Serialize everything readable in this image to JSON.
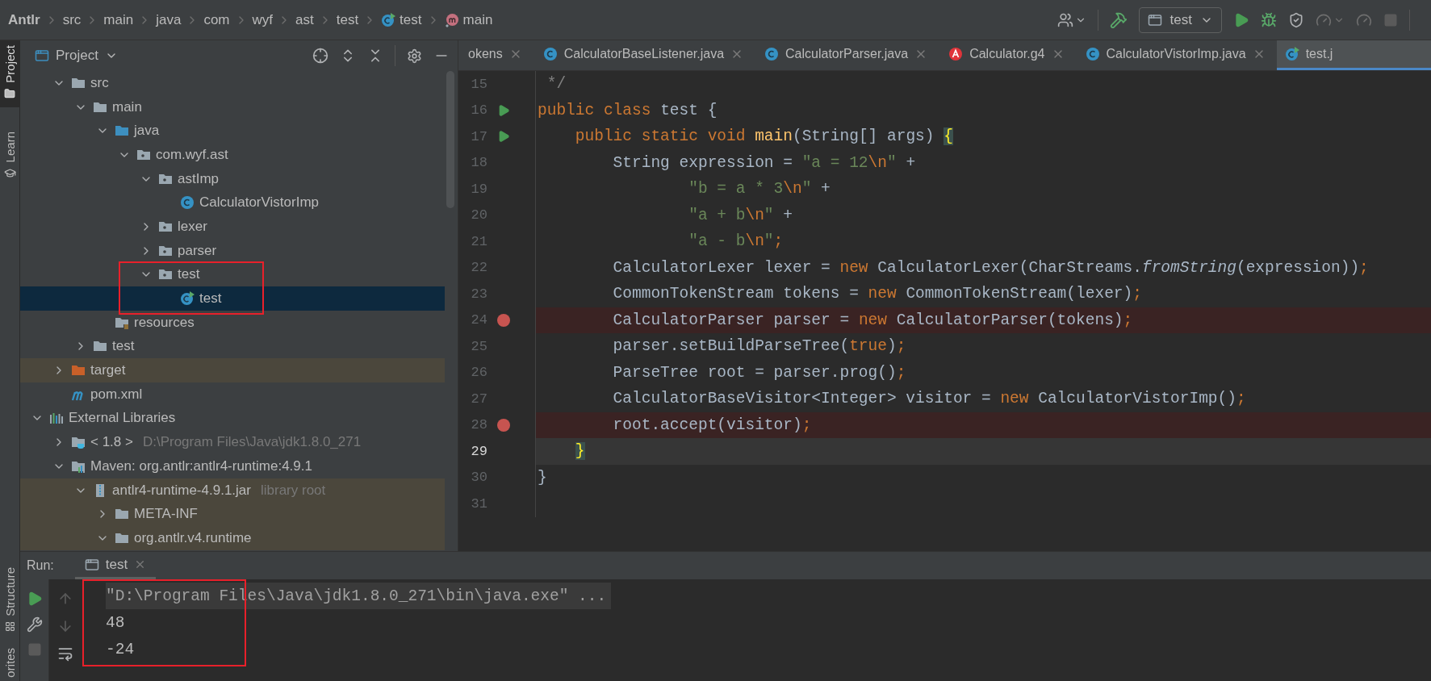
{
  "breadcrumbs": [
    {
      "label": "Antlr",
      "kind": "project"
    },
    {
      "label": "src",
      "kind": "plain"
    },
    {
      "label": "main",
      "kind": "plain"
    },
    {
      "label": "java",
      "kind": "plain"
    },
    {
      "label": "com",
      "kind": "plain"
    },
    {
      "label": "wyf",
      "kind": "plain"
    },
    {
      "label": "ast",
      "kind": "plain"
    },
    {
      "label": "test",
      "kind": "plain"
    },
    {
      "label": "test",
      "kind": "run-class"
    },
    {
      "label": "main",
      "kind": "method"
    }
  ],
  "toolbar": {
    "run_config": "test"
  },
  "side_tabs_top": [
    {
      "label": "Project",
      "selected": true,
      "kind": "folder"
    },
    {
      "label": "Learn",
      "selected": false,
      "kind": "hat"
    }
  ],
  "side_tabs_bottom": [
    {
      "label": "Structure",
      "kind": "structure"
    },
    {
      "label": "orites",
      "kind": "none"
    }
  ],
  "project_panel": {
    "title": "Project"
  },
  "tree": {
    "project_children": [
      {
        "label": "src",
        "kind": "folder",
        "expanded": true,
        "selected": false,
        "shaded": false,
        "children": [
          {
            "label": "main",
            "kind": "folder",
            "expanded": true,
            "selected": false,
            "shaded": false,
            "children": [
              {
                "label": "java",
                "kind": "source-folder",
                "expanded": true,
                "selected": false,
                "shaded": false,
                "children": [
                  {
                    "label": "com.wyf.ast",
                    "kind": "package",
                    "expanded": true,
                    "selected": false,
                    "shaded": false,
                    "children": [
                      {
                        "label": "astImp",
                        "kind": "package",
                        "expanded": true,
                        "selected": false,
                        "shaded": false,
                        "children": [
                          {
                            "label": "CalculatorVistorImp",
                            "kind": "class",
                            "selected": false,
                            "shaded": false
                          }
                        ]
                      },
                      {
                        "label": "lexer",
                        "kind": "package",
                        "expanded": false,
                        "selected": false,
                        "shaded": false
                      },
                      {
                        "label": "parser",
                        "kind": "package",
                        "expanded": false,
                        "selected": false,
                        "shaded": false
                      },
                      {
                        "label": "test",
                        "kind": "package",
                        "expanded": true,
                        "selected": false,
                        "shaded": false,
                        "children": [
                          {
                            "label": "test",
                            "kind": "run-class",
                            "selected": true,
                            "shaded": false
                          }
                        ]
                      }
                    ]
                  }
                ]
              },
              {
                "label": "resources",
                "kind": "resources",
                "selected": false,
                "shaded": false
              }
            ]
          },
          {
            "label": "test",
            "kind": "folder",
            "expanded": false,
            "selected": false,
            "shaded": false
          }
        ]
      },
      {
        "label": "target",
        "kind": "target",
        "expanded": false,
        "selected": false,
        "shaded": true
      },
      {
        "label": "pom.xml",
        "kind": "maven",
        "selected": false,
        "shaded": false
      }
    ],
    "items": [
      {
        "label": "External Libraries",
        "kind": "libraries",
        "expanded": true,
        "selected": false,
        "shaded": false,
        "children": [
          {
            "label": "< 1.8 >",
            "hint": "D:\\Program Files\\Java\\jdk1.8.0_271",
            "kind": "jdk",
            "expanded": false,
            "selected": false,
            "shaded": false
          },
          {
            "label": "Maven: org.antlr:antlr4-runtime:4.9.1",
            "kind": "maven-lib",
            "expanded": true,
            "selected": false,
            "shaded": false,
            "children": [
              {
                "label": "antlr4-runtime-4.9.1.jar",
                "hint": "library root",
                "kind": "jar",
                "expanded": true,
                "selected": false,
                "shaded": true,
                "children": [
                  {
                    "label": "META-INF",
                    "kind": "folder",
                    "expanded": false,
                    "selected": false,
                    "shaded": true
                  },
                  {
                    "label": "org.antlr.v4.runtime",
                    "kind": "folder",
                    "expanded": true,
                    "selected": false,
                    "shaded": true
                  }
                ]
              }
            ]
          }
        ]
      }
    ]
  },
  "editor_tabs": [
    {
      "label": "okens",
      "kind": "none",
      "selected": false
    },
    {
      "label": "CalculatorBaseListener.java",
      "kind": "class",
      "selected": false
    },
    {
      "label": "CalculatorParser.java",
      "kind": "class",
      "selected": false
    },
    {
      "label": "Calculator.g4",
      "kind": "antlr",
      "selected": false
    },
    {
      "label": "CalculatorVistorImp.java",
      "kind": "class",
      "selected": false
    },
    {
      "label": "test.j",
      "kind": "run-class",
      "selected": true
    }
  ],
  "code_lines": [
    {
      "number": "15",
      "kind": "plain",
      "current": false,
      "tokens": [
        {
          "text": " */",
          "kind": "comment"
        }
      ]
    },
    {
      "number": "16",
      "kind": "run",
      "current": false,
      "tokens": [
        {
          "text": "public",
          "kind": "keyword"
        },
        {
          "text": " class",
          "kind": "keyword"
        },
        {
          "text": " test {",
          "kind": "plain"
        }
      ]
    },
    {
      "number": "17",
      "kind": "run",
      "current": false,
      "tokens": [
        {
          "text": "    public static void",
          "kind": "keyword"
        },
        {
          "text": " main",
          "kind": "method"
        },
        {
          "text": "(String[] args) ",
          "kind": "plain"
        },
        {
          "text": "{",
          "kind": "brace"
        }
      ]
    },
    {
      "number": "18",
      "kind": "plain",
      "current": false,
      "tokens": [
        {
          "text": "        String expression = ",
          "kind": "plain"
        },
        {
          "text": "\"a = 12",
          "kind": "string"
        },
        {
          "text": "\\n",
          "kind": "escape"
        },
        {
          "text": "\"",
          "kind": "string"
        },
        {
          "text": " +",
          "kind": "plain"
        }
      ]
    },
    {
      "number": "19",
      "kind": "plain",
      "current": false,
      "tokens": [
        {
          "text": "                \"b = a * 3",
          "kind": "string"
        },
        {
          "text": "\\n",
          "kind": "escape"
        },
        {
          "text": "\"",
          "kind": "string"
        },
        {
          "text": " +",
          "kind": "plain"
        }
      ]
    },
    {
      "number": "20",
      "kind": "plain",
      "current": false,
      "tokens": [
        {
          "text": "                \"a + b",
          "kind": "string"
        },
        {
          "text": "\\n",
          "kind": "escape"
        },
        {
          "text": "\"",
          "kind": "string"
        },
        {
          "text": " +",
          "kind": "plain"
        }
      ]
    },
    {
      "number": "21",
      "kind": "plain",
      "current": false,
      "tokens": [
        {
          "text": "                \"a - b",
          "kind": "string"
        },
        {
          "text": "\\n",
          "kind": "escape"
        },
        {
          "text": "\"",
          "kind": "string"
        },
        {
          "text": ";",
          "kind": "keyword"
        }
      ]
    },
    {
      "number": "22",
      "kind": "plain",
      "current": false,
      "tokens": [
        {
          "text": "        CalculatorLexer lexer = ",
          "kind": "plain"
        },
        {
          "text": "new",
          "kind": "keyword"
        },
        {
          "text": " CalculatorLexer(CharStreams.",
          "kind": "plain"
        },
        {
          "text": "fromString",
          "kind": "static"
        },
        {
          "text": "(expression))",
          "kind": "plain"
        },
        {
          "text": ";",
          "kind": "keyword"
        }
      ]
    },
    {
      "number": "23",
      "kind": "plain",
      "current": false,
      "tokens": [
        {
          "text": "        CommonTokenStream tokens = ",
          "kind": "plain"
        },
        {
          "text": "new",
          "kind": "keyword"
        },
        {
          "text": " CommonTokenStream(lexer)",
          "kind": "plain"
        },
        {
          "text": ";",
          "kind": "keyword"
        }
      ]
    },
    {
      "number": "24",
      "kind": "breakpoint",
      "current": false,
      "tokens": [
        {
          "text": "        CalculatorParser parser = ",
          "kind": "plain"
        },
        {
          "text": "new",
          "kind": "keyword"
        },
        {
          "text": " CalculatorParser(tokens)",
          "kind": "plain"
        },
        {
          "text": ";",
          "kind": "keyword"
        }
      ]
    },
    {
      "number": "25",
      "kind": "plain",
      "current": false,
      "tokens": [
        {
          "text": "        parser.setBuildParseTree(",
          "kind": "plain"
        },
        {
          "text": "true",
          "kind": "keyword"
        },
        {
          "text": ")",
          "kind": "plain"
        },
        {
          "text": ";",
          "kind": "keyword"
        }
      ]
    },
    {
      "number": "26",
      "kind": "plain",
      "current": false,
      "tokens": [
        {
          "text": "        ParseTree root = parser.prog()",
          "kind": "plain"
        },
        {
          "text": ";",
          "kind": "keyword"
        }
      ]
    },
    {
      "number": "27",
      "kind": "plain",
      "current": false,
      "tokens": [
        {
          "text": "        CalculatorBaseVisitor<Integer> visitor = ",
          "kind": "plain"
        },
        {
          "text": "new",
          "kind": "keyword"
        },
        {
          "text": " CalculatorVistorImp()",
          "kind": "plain"
        },
        {
          "text": ";",
          "kind": "keyword"
        }
      ]
    },
    {
      "number": "28",
      "kind": "breakpoint",
      "current": false,
      "tokens": [
        {
          "text": "        root.accept(visitor)",
          "kind": "plain"
        },
        {
          "text": ";",
          "kind": "keyword"
        }
      ]
    },
    {
      "number": "29",
      "kind": "plain",
      "current": true,
      "tokens": [
        {
          "text": "    }",
          "kind": "brace"
        }
      ]
    },
    {
      "number": "30",
      "kind": "plain",
      "current": false,
      "tokens": [
        {
          "text": "}",
          "kind": "plain"
        }
      ]
    },
    {
      "number": "31",
      "kind": "plain",
      "current": false
    }
  ],
  "run_panel": {
    "label": "Run:",
    "tab": "test",
    "console": [
      {
        "text": "\"D:\\Program Files\\Java\\jdk1.8.0_271\\bin\\java.exe\" ...",
        "kind": "command"
      },
      {
        "text": "48",
        "kind": "output"
      },
      {
        "text": "-24",
        "kind": "output"
      }
    ]
  },
  "annotations": [
    {
      "kind": "frame"
    },
    {
      "kind": "frame"
    }
  ]
}
